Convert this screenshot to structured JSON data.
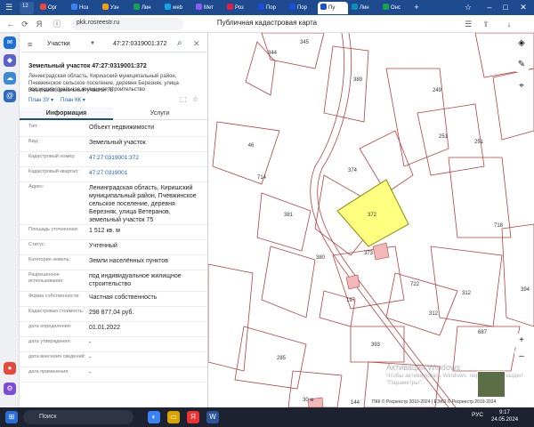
{
  "browser": {
    "tabs": [
      "Орг",
      "Ноз",
      "Узн",
      "Лин",
      "web",
      "Мет",
      "Роз",
      "Пор",
      "Пор",
      "Пу",
      "Лин",
      "Онс"
    ],
    "active_tab_index": 9,
    "url": "pkk.rosreestr.ru",
    "page_title": "Публичная кадастровая карта",
    "tab_counter": "12"
  },
  "search": {
    "category": "Участки",
    "query": "47:27:0319001:372"
  },
  "object": {
    "title": "Земельный участок 47:27:0319001:372",
    "address_short": "Ленинградская область, Киришский муниципальный район, Пчевжинское сельское поселение, деревня Березняк, улица Ветеранов, земельный участок 75",
    "use": "под индивидуальное жилищное строительство",
    "link_plan_zu": "План ЗУ",
    "link_plan_kk": "План КК"
  },
  "panel_tabs": [
    "Информация",
    "Услуги"
  ],
  "info_rows": [
    {
      "k": "Тип:",
      "v": "Объект недвижимости"
    },
    {
      "k": "Вид:",
      "v": "Земельный участок"
    },
    {
      "k": "Кадастровый номер:",
      "v": "47:27:0319001:372"
    },
    {
      "k": "Кадастровый квартал:",
      "v": "47:27:0319001"
    },
    {
      "k": "Адрес:",
      "v": "Ленинградская область, Киришский муниципальный район, Пчевжинское сельское поселение, деревня Березняк, улица Ветеранов, земельный участок 75"
    },
    {
      "k": "Площадь уточненная:",
      "v": "1 512 кв. м"
    },
    {
      "k": "Статус:",
      "v": "Учтенный"
    },
    {
      "k": "Категория земель:",
      "v": "Земли населённых пунктов"
    },
    {
      "k": "Разрешенное использование:",
      "v": "под индивидуальное жилищное строительство"
    },
    {
      "k": "Форма собственности:",
      "v": "Частная собственность"
    },
    {
      "k": "Кадастровая стоимость:",
      "v": "298 877,04 руб."
    },
    {
      "k": "дата определения:",
      "v": "01.01.2022"
    },
    {
      "k": "дата утверждения:",
      "v": "-"
    },
    {
      "k": "дата внесения сведений:",
      "v": "-"
    },
    {
      "k": "дата применения:",
      "v": "-"
    }
  ],
  "map": {
    "parcel_labels": [
      "345",
      "344",
      "389",
      "46",
      "374",
      "249",
      "251",
      "251",
      "372",
      "381",
      "373",
      "380",
      "718",
      "722",
      "312",
      "312",
      "394",
      "197",
      "687",
      "393",
      "285",
      "144",
      "714"
    ],
    "highlight_color": "#ffff80",
    "watermark_title": "Активация Windows",
    "watermark_text": "Чтобы активировать Windows, перейдите в раздел \"Параметры\".",
    "scale": "30 м",
    "copyright": "ПКК © Росреестр 2010-2024 | ЕЭКО © Росреестр 2019-2024"
  },
  "taskbar": {
    "search_placeholder": "Поиск",
    "lang": "РУС",
    "time": "9:17",
    "date": "24.05.2024"
  }
}
